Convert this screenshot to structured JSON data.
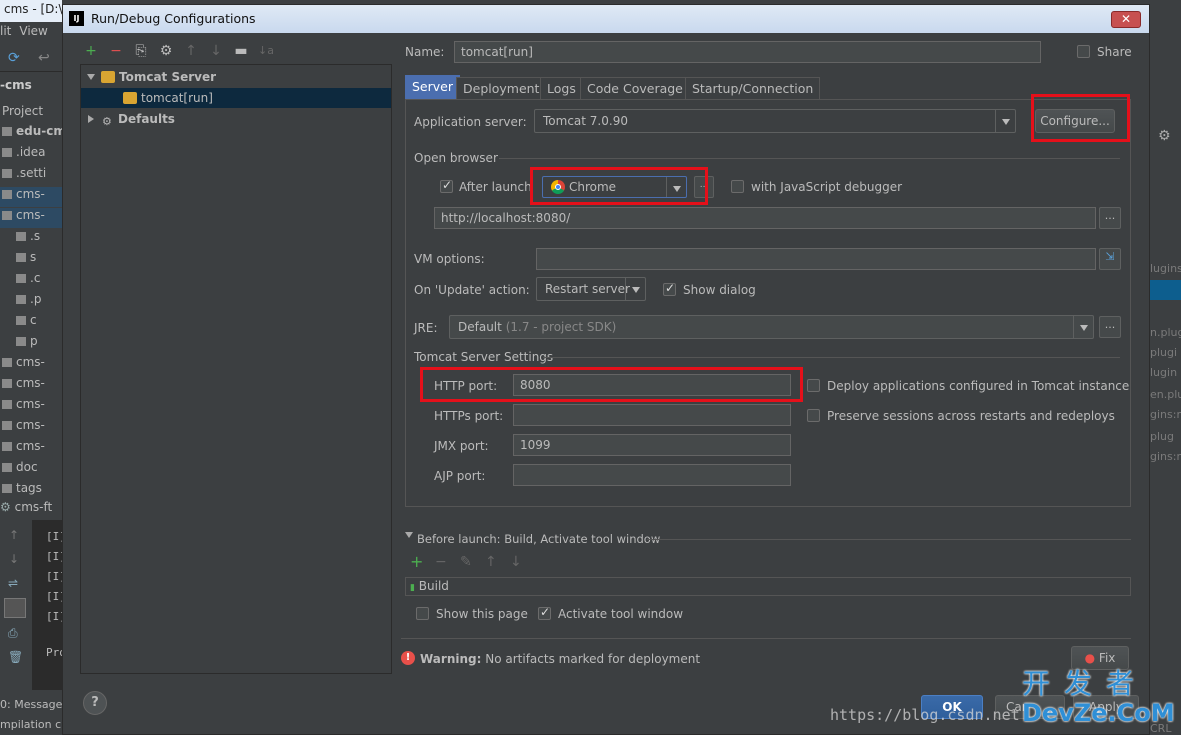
{
  "ide": {
    "title": "cms - [D:\\",
    "menu": [
      "lit",
      "View"
    ],
    "breadcrumb": "-cms",
    "project_label": "Project",
    "tree": [
      {
        "label": "edu-cm",
        "bold": true
      },
      {
        "label": ".idea"
      },
      {
        "label": ".setti"
      },
      {
        "label": "cms-"
      },
      {
        "label": "cms-"
      },
      {
        "label": ".s"
      },
      {
        "label": "s"
      },
      {
        "label": ".c"
      },
      {
        "label": ".p"
      },
      {
        "label": "c"
      },
      {
        "label": "p"
      },
      {
        "label": "cms-"
      },
      {
        "label": "cms-"
      },
      {
        "label": "cms-"
      },
      {
        "label": "cms-"
      },
      {
        "label": "cms-"
      },
      {
        "label": "doc"
      },
      {
        "label": "tags"
      }
    ],
    "run_tab": "cms-ft",
    "console_lines": [
      "[I]",
      "[I]",
      "[I]",
      "[I]",
      "[I]",
      "Pro"
    ],
    "messages_tab": "0: Messages",
    "status": "mpilation c",
    "right_fragments": [
      "lugins",
      "n.plug",
      "plugi",
      "lugin",
      "en.plu",
      "gins:n",
      "plug",
      "gins:n",
      "CRL"
    ]
  },
  "dialog": {
    "title": "Run/Debug Configurations",
    "close_label": "✕",
    "toolbar": [
      "+",
      "−",
      "⎘",
      "⚙",
      "↑",
      "↓",
      "▬",
      "↓a"
    ],
    "tree": {
      "group_label": "Tomcat Server",
      "child_label": "tomcat[run]",
      "defaults_label": "Defaults"
    },
    "name_label": "Name:",
    "name_value": "tomcat[run]",
    "share_label": "Share",
    "tabs": [
      "Server",
      "Deployment",
      "Logs",
      "Code Coverage",
      "Startup/Connection"
    ],
    "app_server_label": "Application server:",
    "app_server_value": "Tomcat 7.0.90",
    "configure_label": "Configure...",
    "open_browser_label": "Open browser",
    "after_launch_label": "After launch",
    "browser_value": "Chrome",
    "js_debugger_label": "with JavaScript debugger",
    "url_value": "http://localhost:8080/",
    "dots_label": "...",
    "vm_options_label": "VM options:",
    "on_update_label": "On 'Update' action:",
    "on_update_value": "Restart server",
    "show_dialog_label": "Show dialog",
    "jre_label": "JRE:",
    "jre_value": "Default",
    "jre_hint": "(1.7 - project SDK)",
    "tomcat_settings_label": "Tomcat Server Settings",
    "http_port_label": "HTTP port:",
    "http_port_value": "8080",
    "https_port_label": "HTTPs port:",
    "https_port_value": "",
    "jmx_port_label": "JMX port:",
    "jmx_port_value": "1099",
    "ajp_port_label": "AJP port:",
    "ajp_port_value": "",
    "deploy_apps_label": "Deploy applications configured in Tomcat instance",
    "preserve_sessions_label": "Preserve sessions across restarts and redeploys",
    "before_launch_label": "Before launch: Build, Activate tool window",
    "before_launch_tools": [
      "+",
      "−",
      "✎",
      "↑",
      "↓"
    ],
    "build_label": "Build",
    "show_page_label": "Show this page",
    "activate_tool_label": "Activate tool window",
    "warning_bold": "Warning:",
    "warning_text": "No artifacts marked for deployment",
    "fix_label": "Fix",
    "help_label": "?",
    "ok_label": "OK",
    "cancel_label": "Can",
    "apply_label": "Apply"
  },
  "watermark": {
    "url": "https://blog.csdn.net",
    "logo_cn": "开发者",
    "logo_en": "DevZe.CoM"
  }
}
